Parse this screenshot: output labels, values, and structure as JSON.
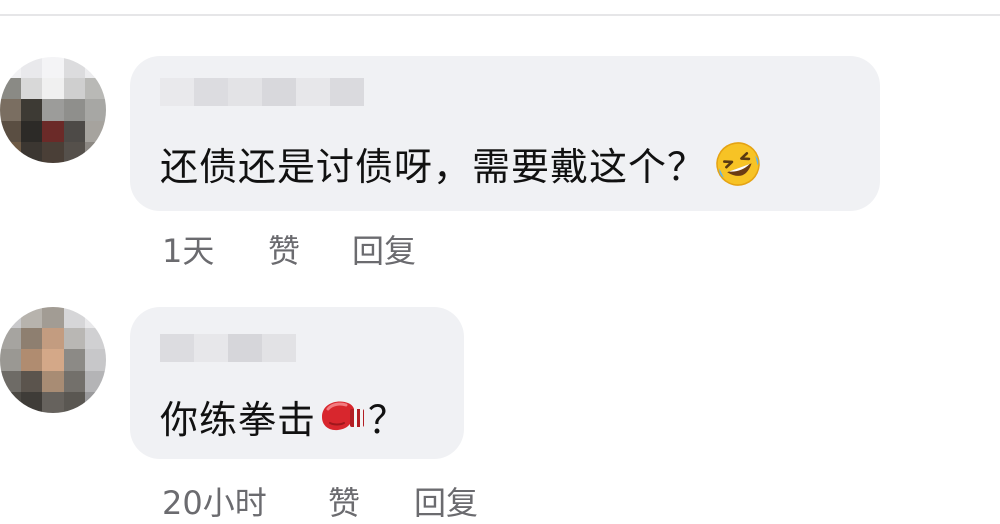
{
  "comments": [
    {
      "text": "还债还是讨债呀，需要戴这个？",
      "emoji": "rofl-emoji",
      "time": "1天",
      "like_label": "赞",
      "reply_label": "回复"
    },
    {
      "text": "你练拳击",
      "text_suffix": "？",
      "emoji": "boxing-glove-emoji",
      "time": "20小时",
      "like_label": "赞",
      "reply_label": "回复"
    }
  ],
  "colors": {
    "bubble": "#f0f1f4",
    "text": "#111111",
    "meta": "#6b6b6f"
  }
}
